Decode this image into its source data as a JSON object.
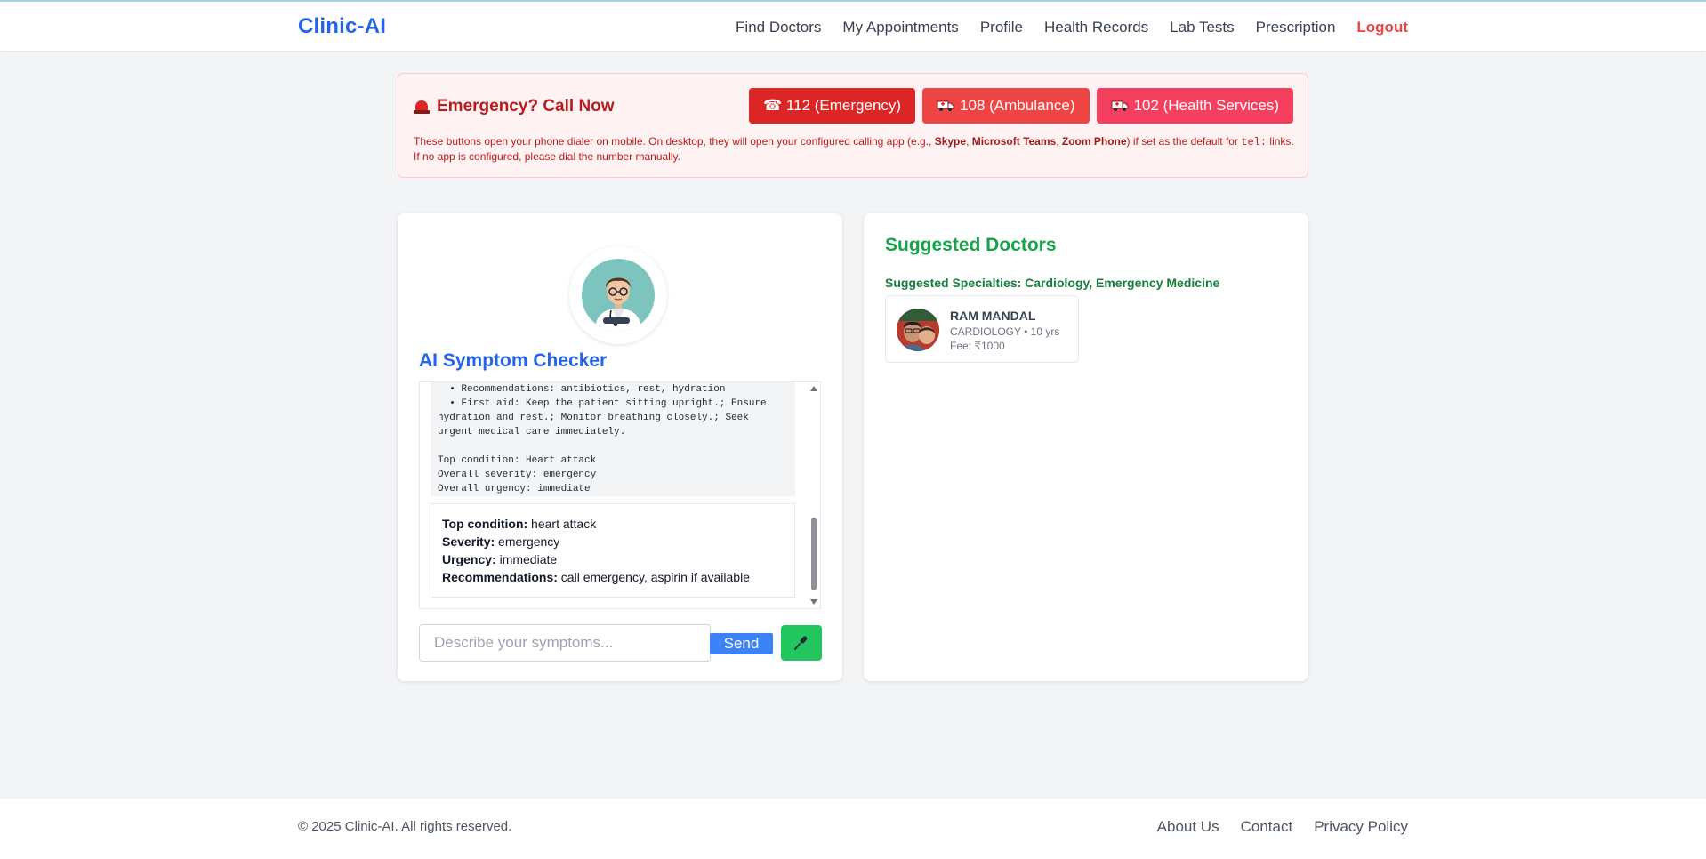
{
  "header": {
    "brand": "Clinic-AI",
    "nav": [
      "Find Doctors",
      "My Appointments",
      "Profile",
      "Health Records",
      "Lab Tests",
      "Prescription"
    ],
    "logout": "Logout"
  },
  "emergency": {
    "title": "Emergency? Call Now",
    "buttons": [
      {
        "label": "☎ 112 (Emergency)",
        "icon": "phone-icon"
      },
      {
        "label": "108 (Ambulance)",
        "icon": "ambulance-icon"
      },
      {
        "label": "102 (Health Services)",
        "icon": "ambulance-icon"
      }
    ],
    "note": {
      "p1": "These buttons open your phone dialer on mobile. On desktop, they will open your configured calling app (e.g., ",
      "skype": "Skype",
      "sep1": ", ",
      "teams": "Microsoft Teams",
      "sep2": ", ",
      "zoom": "Zoom Phone",
      "p2": ") if set as the default for ",
      "code": "tel:",
      "p3": " links. If no app is configured, please dial the number manually."
    }
  },
  "checker": {
    "title": "AI Symptom Checker",
    "transcript": "  • Recommendations: antibiotics, rest, hydration\n  • First aid: Keep the patient sitting upright.; Ensure hydration and rest.; Monitor breathing closely.; Seek urgent medical care immediately.\n\nTop condition: Heart attack\nOverall severity: emergency\nOverall urgency: immediate",
    "result": {
      "condition_label": "Top condition:",
      "condition": " heart attack",
      "severity_label": "Severity:",
      "severity": " emergency",
      "urgency_label": "Urgency:",
      "urgency": " immediate",
      "rec_label": "Recommendations:",
      "rec": " call emergency, aspirin if available"
    },
    "input_placeholder": "Describe your symptoms...",
    "send_label": "Send"
  },
  "suggested": {
    "title": "Suggested Doctors",
    "specialties": "Suggested Specialties: Cardiology, Emergency Medicine",
    "doctors": [
      {
        "name": "RAM MANDAL",
        "meta": "CARDIOLOGY • 10 yrs",
        "fee": "Fee: ₹1000"
      }
    ]
  },
  "footer": {
    "copyright": "© 2025 Clinic-AI. All rights reserved.",
    "links": [
      "About Us",
      "Contact",
      "Privacy Policy"
    ]
  },
  "colors": {
    "brand": "#2563eb",
    "danger": "#dc2626",
    "success": "#16a34a"
  }
}
